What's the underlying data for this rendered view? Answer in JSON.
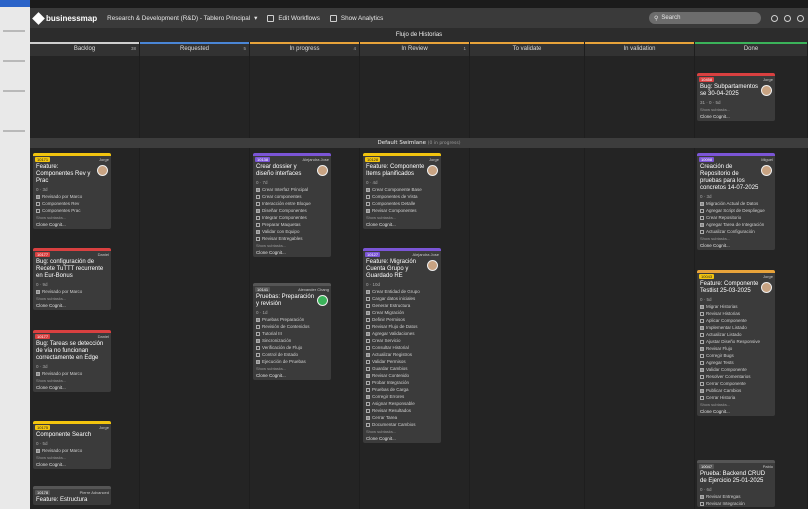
{
  "topbar": {
    "logo": "businessmap",
    "board_path": "Research & Development (R&D) - Tablero Principal",
    "edit_workflows": "Edit Workflows",
    "show_analytics": "Show Analytics",
    "search_placeholder": "Search"
  },
  "board": {
    "title": "Flujo de Historias"
  },
  "columns": [
    {
      "label": "Backlog",
      "count": "38",
      "accent": "#cfcfcf"
    },
    {
      "label": "Requested",
      "count": "5",
      "accent": "#4a86d6"
    },
    {
      "label": "In progress",
      "count": "4",
      "accent": "#e8a33a"
    },
    {
      "label": "In Review",
      "count": "1",
      "accent": "#e8a33a"
    },
    {
      "label": "To validate",
      "count": "",
      "accent": "#e8a33a"
    },
    {
      "label": "In validation",
      "count": "",
      "accent": "#e8a33a"
    },
    {
      "label": "Done",
      "count": "",
      "accent": "#3bb35a"
    }
  ],
  "swimlane": {
    "label": "Default Swimlane",
    "sub": "(0 in progress)"
  },
  "cards": {
    "done_top": {
      "id": "10458",
      "owner": "Jorge",
      "title": "Bug: Subpartamentos se 30-04-2025",
      "stats": "31 · 0 · 5d",
      "more": "Show subtasks...",
      "link": "Clone Cognit..."
    },
    "backlog_1": {
      "id": "10171",
      "owner": "Jorge",
      "title": "Feature: Componentes Rev y Prac",
      "stats": "0 · 3d",
      "items": [
        "Revisado por Marco",
        "Componentes Rev",
        "Componentes Prac"
      ],
      "more": "Show subtasks...",
      "link": "Clone Cognit..."
    },
    "backlog_2": {
      "id": "10177",
      "owner": "Daniel",
      "title": "Bug: configuración de Recete TuTTT recurrente en Eur-Bonus",
      "stats": "0 · 9d",
      "items": [
        "Revisado por Marco"
      ],
      "more": "Show subtasks...",
      "link": "Clone Cognit..."
    },
    "backlog_3": {
      "id": "10177",
      "owner": "Daniel",
      "title": "Bug: Tareas se detección de vía no funcionan correctamente en Edge",
      "stats": "0 · 3d",
      "items": [
        "Revisado por Marco"
      ],
      "more": "Show subtasks...",
      "link": "Clone Cognit..."
    },
    "backlog_4": {
      "id": "10175",
      "owner": "Jorge",
      "title": "Componente Search",
      "stats": "0 · 5d",
      "items": [
        "Revisado por Marco"
      ],
      "more": "Show subtasks...",
      "link": "Clone Cognit..."
    },
    "backlog_5": {
      "id": "10178",
      "owner": "Pierre Advanced",
      "title": "Feature: Estructura",
      "stats": "",
      "items": [],
      "more": "",
      "link": ""
    },
    "inprog_1": {
      "id": "10138",
      "owner": "Alejandra Jose",
      "title": "Crear dossier y diseño interfaces",
      "stats": "0 · 7d",
      "items": [
        "Crear Interfaz Principal",
        "Crear componentes",
        "Interacción entre Bloque",
        "Diseñar Componentes",
        "Integrar Componentes",
        "Preparar Maquetas",
        "Validar con Equipo",
        "Revisar Entregables"
      ],
      "more": "Show subtasks...",
      "link": "Clone Cognit..."
    },
    "inprog_2": {
      "id": "10141",
      "owner": "Alexander Chang",
      "title": "Pruebas: Preparación y revisión",
      "stats": "0 · 1d",
      "items": [
        "Pruebas Preparación",
        "Revisión de Contenidos",
        "Tutorial III",
        "Sincronización",
        "Verificación de Flujo",
        "Control de Estado",
        "Ejecución de Pruebas"
      ],
      "more": "Show subtasks...",
      "link": "Clone Cognit..."
    },
    "review_1": {
      "id": "10128",
      "owner": "Jorge",
      "title": "Feature: Componente Items planificados",
      "stats": "0 · 4d",
      "items": [
        "Crear Componente Base",
        "Componentes de Vista",
        "Componentes Detalle",
        "Revisar Componentes"
      ],
      "more": "Show subtasks...",
      "link": "Clone Cognit..."
    },
    "review_2": {
      "id": "10127",
      "owner": "Alejandra Jose",
      "title": "Feature: Migración Cuenta Grupo y Guardado RE",
      "stats": "0 · 10d",
      "items": [
        "Crear Entidad de Grupo",
        "Cargar datos iniciales",
        "Generar Estructura",
        "Crear Migración",
        "Definir Permisos",
        "Revisar Flujo de Datos",
        "Agregar Validaciones",
        "Crear Servicio",
        "Consultar Historial",
        "Actualizar Registros",
        "Validar Permisos",
        "Guardar Cambios",
        "Revisar Contenido",
        "Probar Integración",
        "Pruebas de Carga",
        "Corregir Errores",
        "Asignar Responsable",
        "Revisar Resultados",
        "Cerrar Tarea",
        "Documentar Cambios"
      ],
      "more": "Show subtasks...",
      "link": "Clone Cognit..."
    },
    "done_1": {
      "id": "10098",
      "owner": "Miguel",
      "title": "Creación de Repositorio de pruebas para los concretos 14-07-2025",
      "stats": "0 · 3d",
      "items": [
        "Migración Actual de Datos",
        "Agregar Script de Despliegue",
        "Crear Repositorio",
        "Agregar Tarea de Integración",
        "Actualizar Configuración"
      ],
      "more": "Show subtasks...",
      "link": "Clone Cognit..."
    },
    "done_2": {
      "id": "10043",
      "owner": "Jorge",
      "title": "Feature: Componente Testlist 25-03-2025",
      "stats": "0 · 5d",
      "items": [
        "Migrar Historias",
        "Revisar Historias",
        "Aplicar Componente",
        "Implementar Listado",
        "Actualizar Listado",
        "Ajustar Diseño Responsive",
        "Revisar Flujo",
        "Corregir Bugs",
        "Agregar Tests",
        "Validar Componente",
        "Resolver Comentarios",
        "Cerrar Componente",
        "Publicar Cambios",
        "Cerrar Historia"
      ],
      "more": "Show subtasks...",
      "link": "Clone Cognit..."
    },
    "done_3": {
      "id": "10047",
      "owner": "Pablo",
      "title": "Prueba: Backend CRUD de Ejercicio 25-01-2025",
      "stats": "0 · 6d",
      "items": [
        "Revisar Entregas",
        "Revisar Integración"
      ],
      "more": "",
      "link": ""
    }
  }
}
